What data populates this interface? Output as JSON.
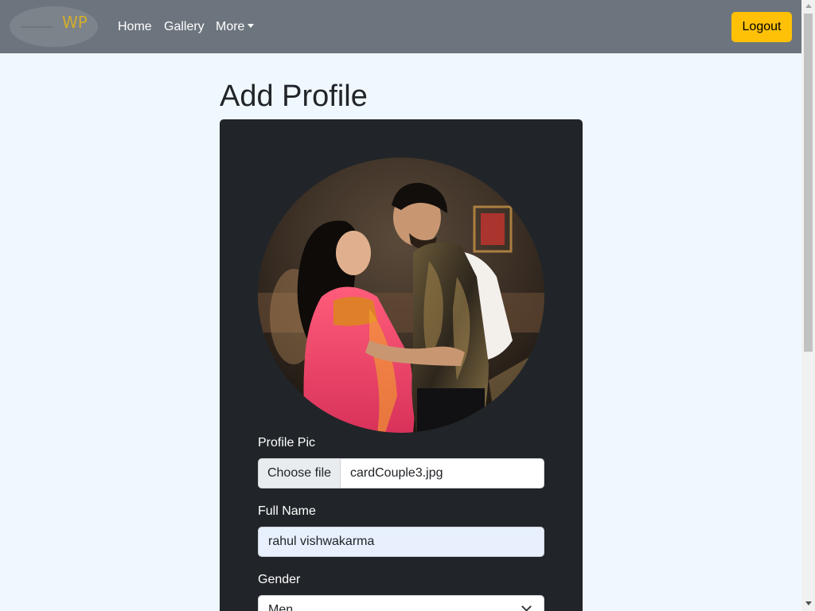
{
  "navbar": {
    "brand_text": "WP",
    "links": [
      {
        "label": "Home"
      },
      {
        "label": "Gallery"
      },
      {
        "label": "More"
      }
    ],
    "logout_label": "Logout"
  },
  "page": {
    "title": "Add Profile"
  },
  "form": {
    "profile_pic_label": "Profile Pic",
    "choose_file_label": "Choose file",
    "file_name": "cardCouple3.jpg",
    "full_name_label": "Full Name",
    "full_name_value": "rahul vishwakarma",
    "gender_label": "Gender",
    "gender_value": "Men"
  },
  "colors": {
    "navbar_bg": "#6c757d",
    "logout_bg": "#ffc107",
    "card_bg": "#212529",
    "page_bg": "#f0f8ff",
    "brand_text": "#d4ad2b"
  }
}
